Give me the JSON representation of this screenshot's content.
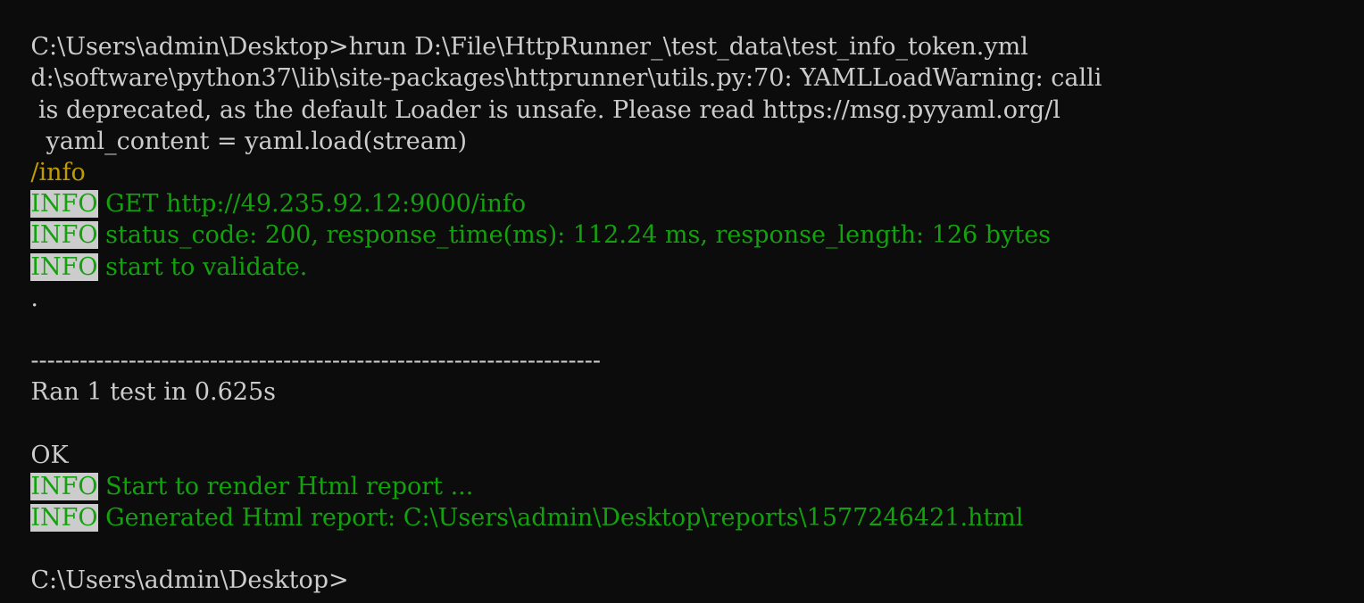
{
  "window": {
    "type": "windows-command-prompt",
    "background_color": "#0c0c0c",
    "default_text_color": "#cccccc",
    "info_text_color": "#13a10e",
    "highlight_color": "#c19c00",
    "badge_background_color": "#cccccc"
  },
  "terminal": {
    "lines": {
      "l01_prompt_command": "C:\\Users\\admin\\Desktop>hrun D:\\File\\HttpRunner_\\test_data\\test_info_token.yml",
      "l02_warning_path": "d:\\software\\python37\\lib\\site-packages\\httprunner\\utils.py:70: YAMLLoadWarning: calli",
      "l03_warning_body": " is deprecated, as the default Loader is unsafe. Please read https://msg.pyyaml.org/l",
      "l04_warning_code": "  yaml_content = yaml.load(stream)",
      "l05_testcase_name": "/info",
      "l06_badge": "INFO",
      "l06_message": "GET http://49.235.92.12:9000/info",
      "l07_badge": "INFO",
      "l07_message": "status_code: 200, response_time(ms): 112.24 ms, response_length: 126 bytes",
      "l08_badge": "INFO",
      "l08_message": "start to validate.",
      "l09_dot": ".",
      "l11_separator": "----------------------------------------------------------------------",
      "l12_summary": "Ran 1 test in 0.625s",
      "l14_result": "OK",
      "l15_badge": "INFO",
      "l15_message": "Start to render Html report ...",
      "l16_badge": "INFO",
      "l16_message": "Generated Html report: C:\\Users\\admin\\Desktop\\reports\\1577246421.html",
      "l18_prompt": "C:\\Users\\admin\\Desktop>"
    },
    "parsed": {
      "command": "hrun D:\\File\\HttpRunner_\\test_data\\test_info_token.yml",
      "prompt": "C:\\Users\\admin\\Desktop>",
      "request_method": "GET",
      "request_url": "http://49.235.92.12:9000/info",
      "status_code": "200",
      "response_time_ms": "112.24",
      "response_length_bytes": "126",
      "tests_run": "1",
      "duration_seconds": "0.625",
      "result": "OK",
      "report_path": "C:\\Users\\admin\\Desktop\\reports\\1577246421.html"
    }
  }
}
